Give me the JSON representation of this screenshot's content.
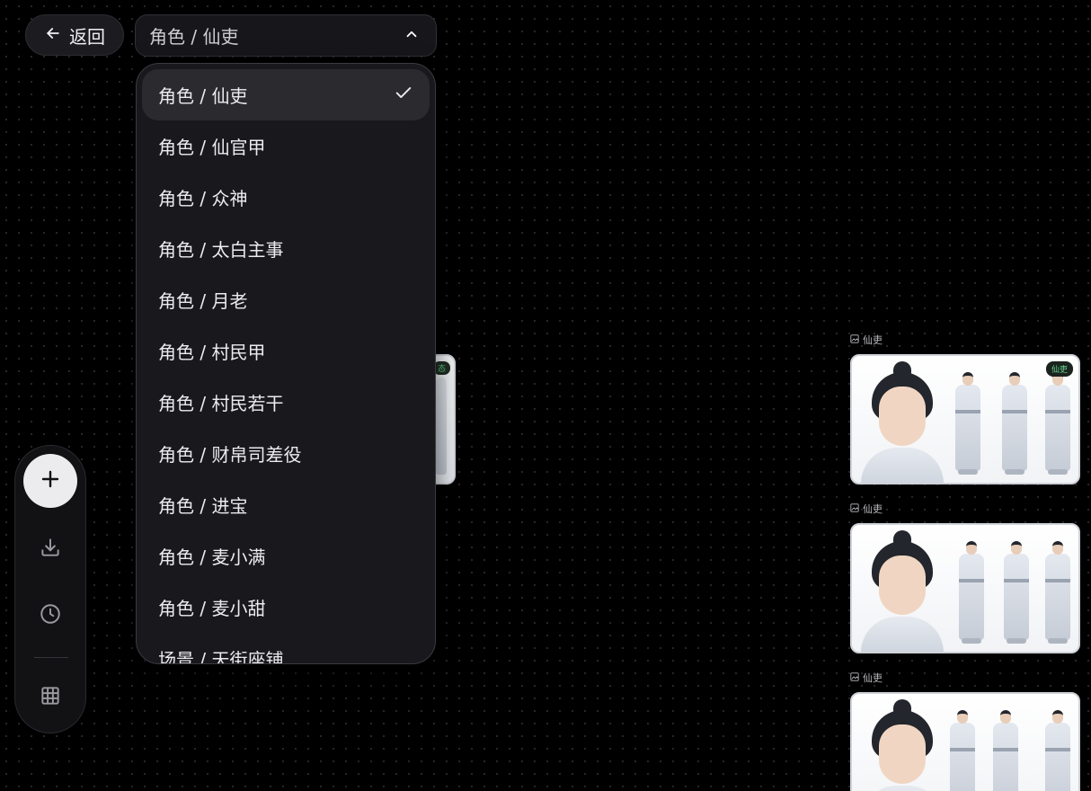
{
  "header": {
    "back_label": "返回",
    "select_value": "角色 / 仙吏"
  },
  "dropdown": {
    "items": [
      {
        "label": "角色 / 仙吏",
        "selected": true
      },
      {
        "label": "角色 / 仙官甲",
        "selected": false
      },
      {
        "label": "角色 / 众神",
        "selected": false
      },
      {
        "label": "角色 / 太白主事",
        "selected": false
      },
      {
        "label": "角色 / 月老",
        "selected": false
      },
      {
        "label": "角色 / 村民甲",
        "selected": false
      },
      {
        "label": "角色 / 村民若干",
        "selected": false
      },
      {
        "label": "角色 / 财帛司差役",
        "selected": false
      },
      {
        "label": "角色 / 进宝",
        "selected": false
      },
      {
        "label": "角色 / 麦小满",
        "selected": false
      },
      {
        "label": "角色 / 麦小甜",
        "selected": false
      },
      {
        "label": "场景 / 天街座铺",
        "selected": false
      }
    ]
  },
  "canvas": {
    "hidden_card_tag": "态",
    "cards": [
      {
        "label": "仙吏",
        "badge": "仙吏"
      },
      {
        "label": "仙吏",
        "badge": ""
      },
      {
        "label": "仙吏",
        "badge": ""
      }
    ]
  },
  "toolbar": {
    "icons": [
      "plus-icon",
      "download-icon",
      "history-icon",
      "grid-icon"
    ]
  },
  "colors": {
    "background": "#000000",
    "panel": "#19191d",
    "selected_row": "#2a2a2f",
    "badge_text": "#66d494"
  }
}
